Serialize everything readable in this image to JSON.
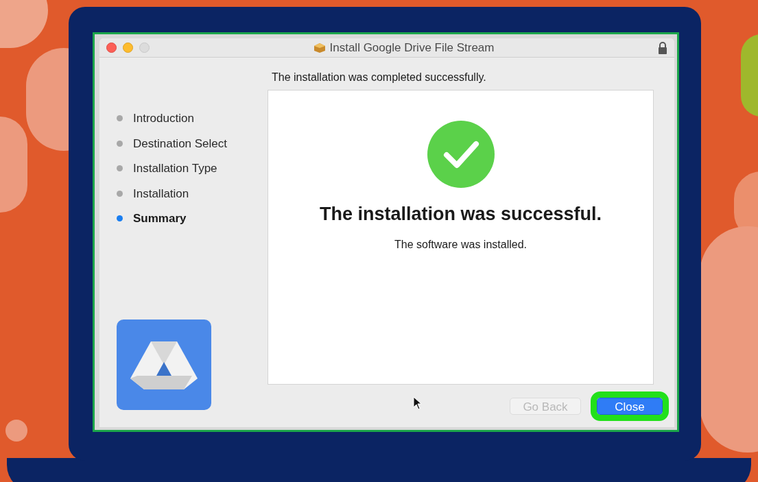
{
  "window": {
    "title": "Install Google Drive File Stream"
  },
  "header": "The installation was completed successfully.",
  "steps": [
    {
      "label": "Introduction",
      "selected": false
    },
    {
      "label": "Destination Select",
      "selected": false
    },
    {
      "label": "Installation Type",
      "selected": false
    },
    {
      "label": "Installation",
      "selected": false
    },
    {
      "label": "Summary",
      "selected": true
    }
  ],
  "result": {
    "title": "The installation was successful.",
    "message": "The software was installed."
  },
  "buttons": [
    {
      "label": "Go Back",
      "disabled": true,
      "highlighted": false
    },
    {
      "label": "Close",
      "disabled": false,
      "highlighted": true
    }
  ]
}
